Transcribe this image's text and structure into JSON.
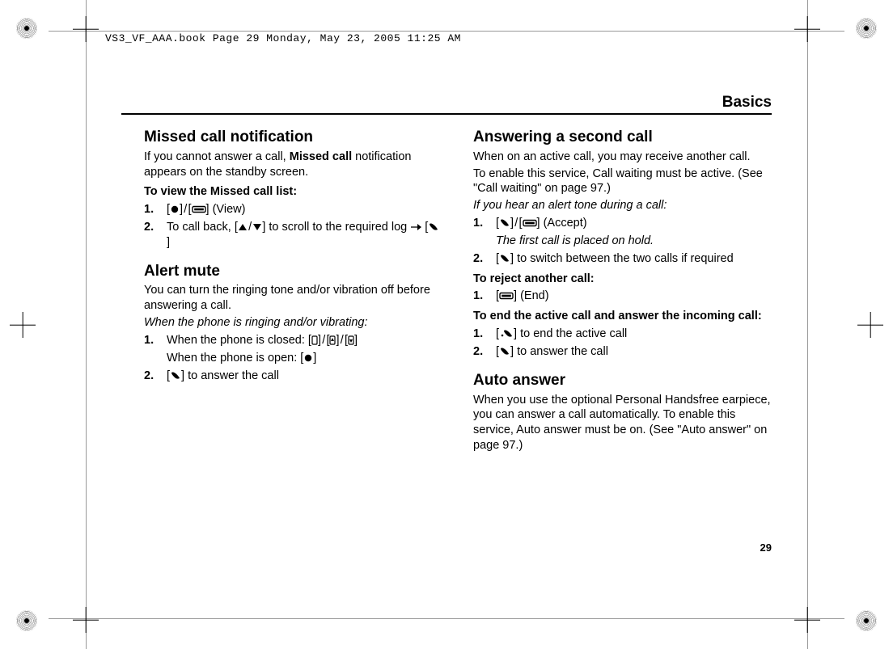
{
  "file_header": "VS3_VF_AAA.book  Page 29  Monday, May 23, 2005  11:25 AM",
  "section_title": "Basics",
  "page_number": "29",
  "left": {
    "s1": {
      "heading": "Missed call notification",
      "p1a": "If you cannot answer a call, ",
      "p1b": "Missed call",
      "p1c": " notification appears on the standby screen.",
      "sub1": "To view the Missed call list:",
      "step1_num": "1.",
      "step1_suffix": " (View)",
      "step2_num": "2.",
      "step2_prefix": "To call back, ",
      "step2_mid": " to scroll to the required log "
    },
    "s2": {
      "heading": "Alert mute",
      "p1": "You can turn the ringing tone and/or vibration off before answering a call.",
      "p2": "When the phone is ringing and/or vibrating:",
      "step1_num": "1.",
      "step1_closed": "When the phone is closed: ",
      "step1_open": "When the phone is open: ",
      "step2_num": "2.",
      "step2_suffix": " to answer the call"
    }
  },
  "right": {
    "s1": {
      "heading": "Answering a second call",
      "p1": "When on an active call, you may receive another call.",
      "p2": "To enable this service, Call waiting must be active. (See \"Call waiting\" on page 97.)",
      "p3": "If you hear an alert tone during a call:",
      "step1_num": "1.",
      "step1_suffix": " (Accept)",
      "step1_note": "The first call is placed on hold.",
      "step2_num": "2.",
      "step2_suffix": " to switch between the two calls if required",
      "sub_reject": "To reject another call:",
      "rej_num": "1.",
      "rej_suffix": " (End)",
      "sub_end": "To end the active call and answer the incoming call:",
      "end1_num": "1.",
      "end1_suffix": " to end the active call",
      "end2_num": "2.",
      "end2_suffix": " to answer the call"
    },
    "s2": {
      "heading": "Auto answer",
      "p1": "When you use the optional Personal Handsfree earpiece, you can answer a call automatically. To enable this service, Auto answer must be on. (See \"Auto answer\" on page 97.)"
    }
  }
}
